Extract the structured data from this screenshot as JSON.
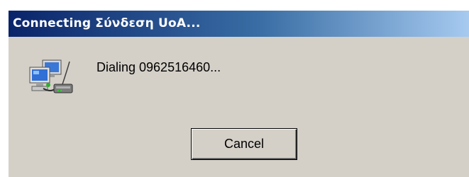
{
  "window": {
    "title": "Connecting Σύνδεση UoA..."
  },
  "message": "Dialing 0962516460...",
  "buttons": {
    "cancel_label": "Cancel"
  },
  "icons": {
    "connection": "network-connection-icon"
  },
  "colors": {
    "titlebar_start": "#0a246a",
    "titlebar_end": "#a6caf0",
    "dialog_background": "#d4d0c8"
  }
}
